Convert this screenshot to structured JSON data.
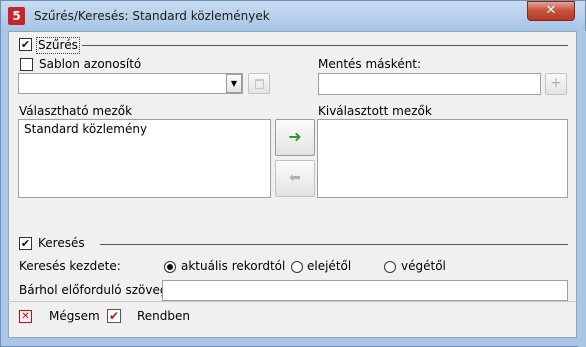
{
  "window": {
    "title": "Szűrés/Keresés: Standard közlemények",
    "app_icon": "5",
    "close_glyph": "✕"
  },
  "filter": {
    "section_label": "Szűrés",
    "checked": true,
    "template_label": "Sablon azonosító",
    "template_checked": false,
    "template_value": "",
    "save_as_label": "Mentés másként:",
    "save_as_value": "",
    "add_glyph": "+",
    "available_label": "Választható mezők",
    "available_items": [
      "Standard közlemény"
    ],
    "selected_label": "Kiválasztott mezők",
    "selected_items": [],
    "move_right_glyph": "➜",
    "move_left_glyph": "⬅"
  },
  "search": {
    "section_label": "Keresés",
    "checked": true,
    "start_label": "Keresés kezdete:",
    "options": [
      "aktuális rekordtól",
      "elejétől",
      "végétől"
    ],
    "selected_option": "aktuális rekordtól",
    "anywhere_label": "Bárhol előforduló szöveg:",
    "anywhere_value": ""
  },
  "footer": {
    "cancel_label": "Mégsem",
    "ok_label": "Rendben",
    "cancel_glyph": "✕",
    "ok_glyph": "✔"
  },
  "colors": {
    "title_bg": "#a9c6e6",
    "close_red": "#c75443",
    "arrow_green": "#2e9a2e",
    "dialog_bg": "#f0f0f0"
  }
}
